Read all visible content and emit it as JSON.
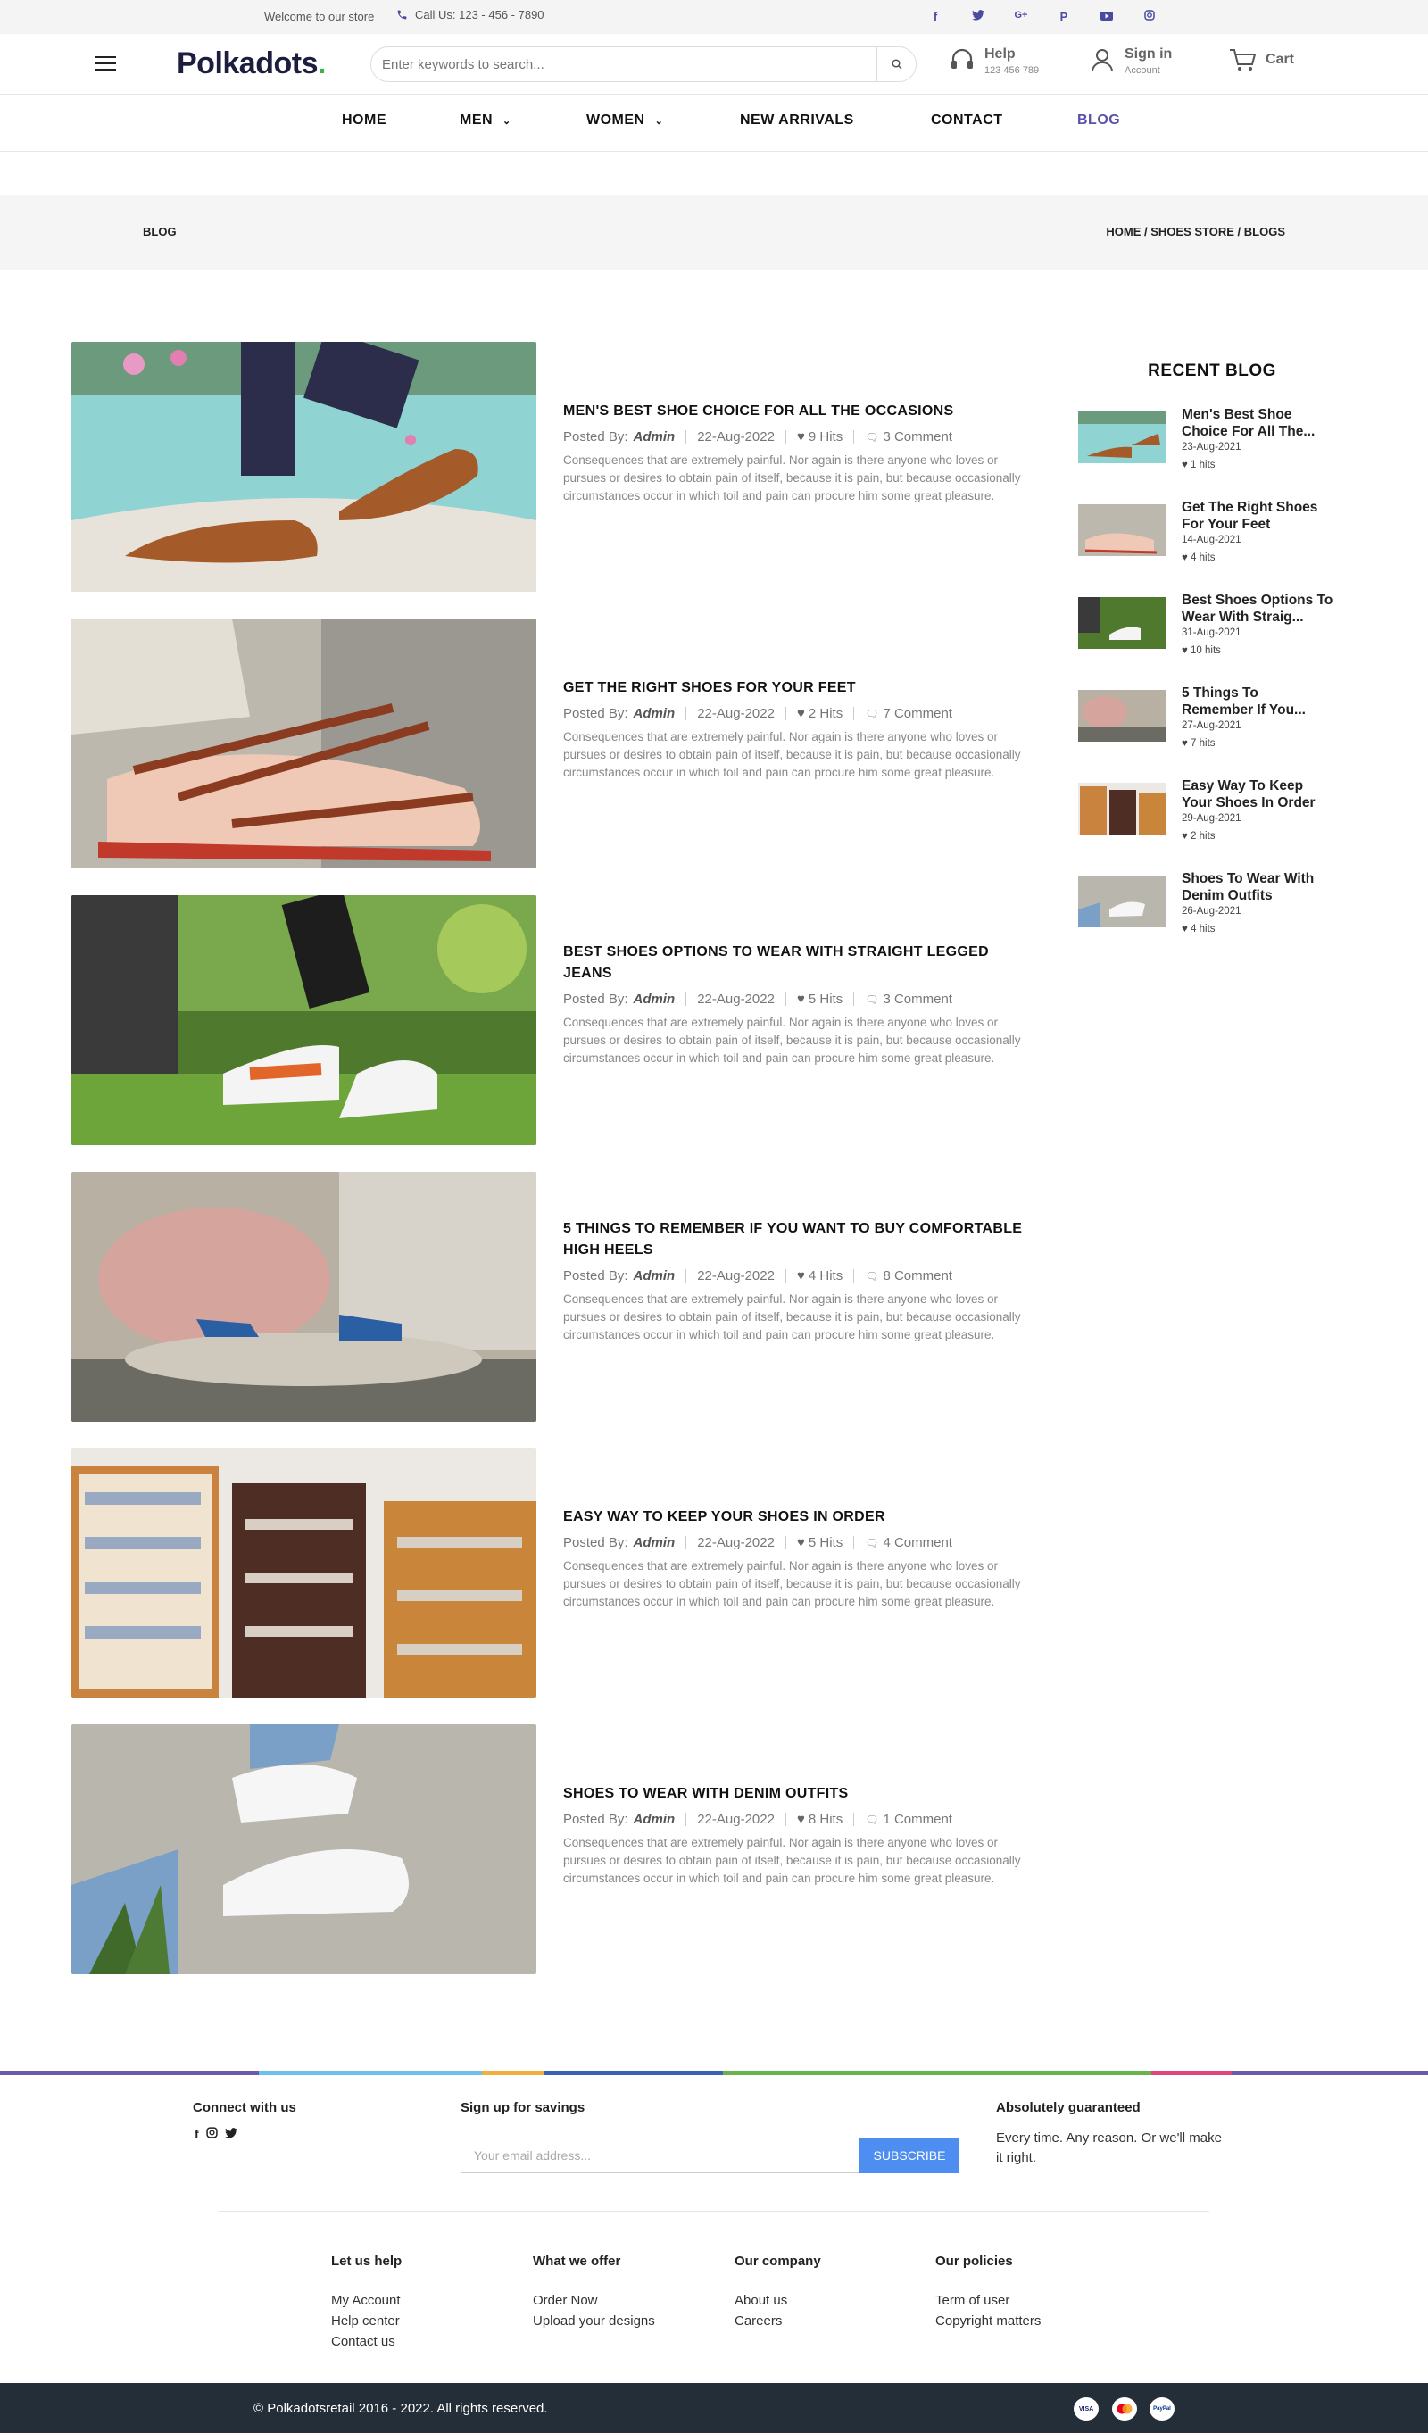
{
  "topbar": {
    "welcome": "Welcome to our store",
    "call": "Call Us: 123 - 456 - 7890",
    "social_icons": [
      "facebook-icon",
      "twitter-icon",
      "google-plus-icon",
      "pinterest-icon",
      "youtube-icon",
      "instagram-icon"
    ]
  },
  "header": {
    "logo": "Polkadots",
    "search_placeholder": "Enter keywords to search...",
    "help_title": "Help",
    "help_sub": "123 456 789",
    "signin_title": "Sign in",
    "signin_sub": "Account",
    "cart": "Cart"
  },
  "nav": {
    "items": [
      "HOME",
      "MEN",
      "WOMEN",
      "NEW ARRIVALS",
      "CONTACT",
      "BLOG"
    ]
  },
  "breadcrumb": {
    "page": "BLOG",
    "path": "HOME / SHOES STORE / BLOGS"
  },
  "posts": [
    {
      "title": "MEN'S BEST SHOE CHOICE FOR ALL THE OCCASIONS",
      "posted_by": "Posted By:",
      "author": "Admin",
      "date": "22-Aug-2022",
      "hits": "9 Hits",
      "comments": "3 Comment",
      "excerpt": "Consequences that are extremely painful. Nor again is there anyone who loves or pursues or desires to obtain pain of itself, because it is pain, but because occasionally circumstances occur in which toil and pain can procure him some great pleasure."
    },
    {
      "title": "GET THE RIGHT SHOES FOR YOUR FEET",
      "posted_by": "Posted By:",
      "author": "Admin",
      "date": "22-Aug-2022",
      "hits": "2 Hits",
      "comments": "7 Comment",
      "excerpt": "Consequences that are extremely painful. Nor again is there anyone who loves or pursues or desires to obtain pain of itself, because it is pain, but because occasionally circumstances occur in which toil and pain can procure him some great pleasure."
    },
    {
      "title": "BEST SHOES OPTIONS TO WEAR WITH STRAIGHT LEGGED JEANS",
      "posted_by": "Posted By:",
      "author": "Admin",
      "date": "22-Aug-2022",
      "hits": "5 Hits",
      "comments": "3 Comment",
      "excerpt": "Consequences that are extremely painful. Nor again is there anyone who loves or pursues or desires to obtain pain of itself, because it is pain, but because occasionally circumstances occur in which toil and pain can procure him some great pleasure."
    },
    {
      "title": "5 THINGS TO REMEMBER IF YOU WANT TO BUY COMFORTABLE HIGH HEELS",
      "posted_by": "Posted By:",
      "author": "Admin",
      "date": "22-Aug-2022",
      "hits": "4 Hits",
      "comments": "8 Comment",
      "excerpt": "Consequences that are extremely painful. Nor again is there anyone who loves or pursues or desires to obtain pain of itself, because it is pain, but because occasionally circumstances occur in which toil and pain can procure him some great pleasure."
    },
    {
      "title": "EASY WAY TO KEEP YOUR SHOES IN ORDER",
      "posted_by": "Posted By:",
      "author": "Admin",
      "date": "22-Aug-2022",
      "hits": "5 Hits",
      "comments": "4 Comment",
      "excerpt": "Consequences that are extremely painful. Nor again is there anyone who loves or pursues or desires to obtain pain of itself, because it is pain, but because occasionally circumstances occur in which toil and pain can procure him some great pleasure."
    },
    {
      "title": "SHOES TO WEAR WITH DENIM OUTFITS",
      "posted_by": "Posted By:",
      "author": "Admin",
      "date": "22-Aug-2022",
      "hits": "8 Hits",
      "comments": "1 Comment",
      "excerpt": "Consequences that are extremely painful. Nor again is there anyone who loves or pursues or desires to obtain pain of itself, because it is pain, but because occasionally circumstances occur in which toil and pain can procure him some great pleasure."
    }
  ],
  "sidebar": {
    "heading": "RECENT BLOG",
    "items": [
      {
        "title": "Men's Best Shoe Choice For All The...",
        "date": "23-Aug-2021",
        "hits": "1 hits"
      },
      {
        "title": "Get The Right Shoes For Your Feet",
        "date": "14-Aug-2021",
        "hits": "4 hits"
      },
      {
        "title": "Best Shoes Options To Wear With Straig...",
        "date": "31-Aug-2021",
        "hits": "10 hits"
      },
      {
        "title": "5 Things To Remember If You...",
        "date": "27-Aug-2021",
        "hits": "7 hits"
      },
      {
        "title": "Easy Way To Keep Your Shoes In Order",
        "date": "29-Aug-2021",
        "hits": "2 hits"
      },
      {
        "title": "Shoes To Wear With Denim Outfits",
        "date": "26-Aug-2021",
        "hits": "4 hits"
      }
    ]
  },
  "footer": {
    "connect": "Connect with us",
    "signup": "Sign up for savings",
    "email_placeholder": "Your email address...",
    "subscribe": "SUBSCRIBE",
    "guarantee_title": "Absolutely guaranteed",
    "guarantee_text": "Every time. Any reason. Or we'll make it right.",
    "columns": [
      {
        "heading": "Let us help",
        "links": [
          "My Account",
          "Help center",
          "Contact us"
        ]
      },
      {
        "heading": "What we offer",
        "links": [
          "Order Now",
          "Upload your designs"
        ]
      },
      {
        "heading": "Our company",
        "links": [
          "About us",
          "Careers"
        ]
      },
      {
        "heading": "Our policies",
        "links": [
          "Term of user",
          "Copyright matters"
        ]
      }
    ],
    "copyright": "© Polkadotsretail 2016 - 2022. All rights reserved.",
    "payments": [
      "VISA",
      "MC",
      "PayPal"
    ]
  },
  "colors": {
    "accent": "#5a51a8",
    "subscribe": "#4d8ef0",
    "footer_bar": "#242e38"
  }
}
